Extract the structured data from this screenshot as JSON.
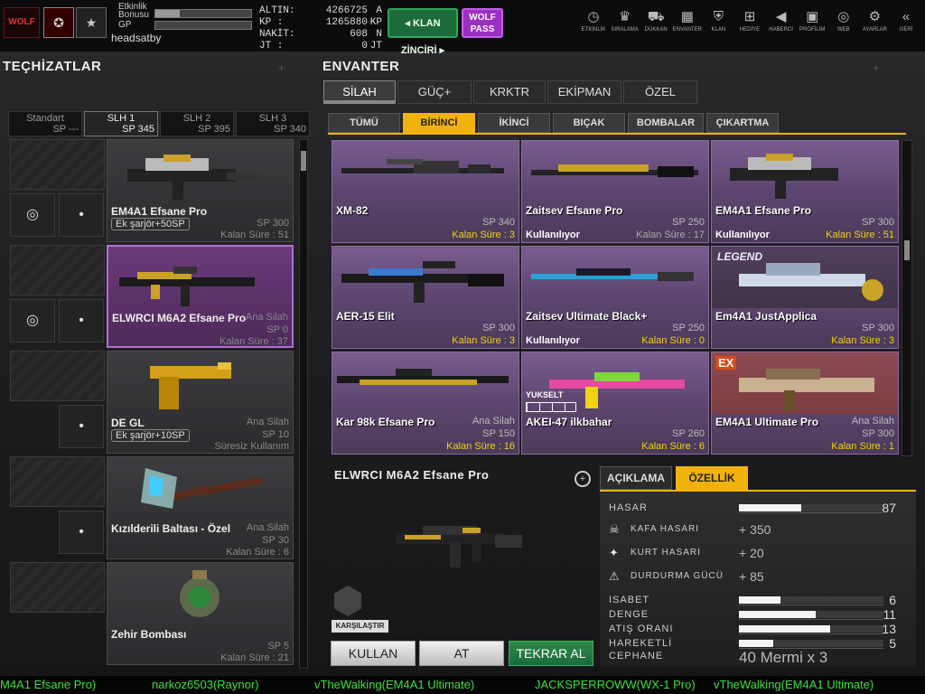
{
  "topbar": {
    "logo_text": "WOLF",
    "event_bonus_label": "Etkinlik Bonusu",
    "event_bonus_fill": 0.25,
    "gp_label": "GP",
    "gp_fill": 0.0,
    "username": "headsatby",
    "stats": [
      {
        "key": "ALTIN:",
        "value": "4266725",
        "unit": "A"
      },
      {
        "key": "KP :",
        "value": "1265880",
        "unit": "KP"
      },
      {
        "key": "NAKİT:",
        "value": "608",
        "unit": "N"
      },
      {
        "key": "JT :",
        "value": "0",
        "unit": "JT"
      }
    ],
    "klan_button": "KLAN ZİNCİRİ",
    "wolf_pass_line1": "WOLF",
    "wolf_pass_line2": "PASS",
    "nav": [
      {
        "label": "ETKİNLİK",
        "icon": "clock-icon",
        "glyph": "◷"
      },
      {
        "label": "SIRALAMA",
        "icon": "ranking-icon",
        "glyph": "♛"
      },
      {
        "label": "DÜKKAN",
        "icon": "cart-icon",
        "glyph": "⛟"
      },
      {
        "label": "ENVANTER",
        "icon": "inventory-icon",
        "glyph": "▦"
      },
      {
        "label": "KLAN",
        "icon": "shield-icon",
        "glyph": "⛨"
      },
      {
        "label": "HEDİYE",
        "icon": "gift-icon",
        "glyph": "⊞"
      },
      {
        "label": "HABERCİ",
        "icon": "megaphone-icon",
        "glyph": "◀"
      },
      {
        "label": "PROFİLİM",
        "icon": "profile-icon",
        "glyph": "▣"
      },
      {
        "label": "WEB",
        "icon": "globe-icon",
        "glyph": "◎"
      },
      {
        "label": "AYARLAR",
        "icon": "gear-icon",
        "glyph": "⚙"
      },
      {
        "label": "GERİ",
        "icon": "back-icon",
        "glyph": "«"
      }
    ]
  },
  "left": {
    "title": "TEÇHİZATLAR",
    "slots": [
      {
        "name": "Standart",
        "sp": "SP ---"
      },
      {
        "name": "SLH 1",
        "sp": "SP 345"
      },
      {
        "name": "SLH 2",
        "sp": "SP 395"
      },
      {
        "name": "SLH 3",
        "sp": "SP 340"
      }
    ],
    "equipment": [
      {
        "name": "EM4A1 Efsane Pro",
        "slot": "",
        "sp": "SP 300",
        "extra": "Ek şarjör+50SP",
        "time": "Kalan Süre : 51"
      },
      {
        "name": "ELWRCI M6A2 Efsane Pro",
        "slot": "Ana Silah",
        "sp": "SP 0",
        "extra": "",
        "time": "Kalan Süre : 37"
      },
      {
        "name": "DE GL",
        "slot": "Ana Silah",
        "sp": "SP 10",
        "extra": "Ek şarjör+10SP",
        "time": "Süresiz Kullanım"
      },
      {
        "name": "Kızılderili Baltası - Özel",
        "slot": "Ana Silah",
        "sp": "SP 30",
        "extra": "",
        "time": "Kalan Süre : 6"
      },
      {
        "name": "Zehir Bombası",
        "slot": "",
        "sp": "SP 5",
        "extra": "",
        "time": "Kalan Süre : 21"
      }
    ]
  },
  "inventory": {
    "title": "ENVANTER",
    "tabs": [
      "SİLAH",
      "GÜÇ+",
      "KRKTR",
      "EKİPMAN",
      "ÖZEL"
    ],
    "subtabs": [
      "TÜMÜ",
      "BİRİNCİ",
      "İKİNCİ",
      "BIÇAK",
      "BOMBALAR",
      "ÇIKARTMA"
    ],
    "items": [
      {
        "name": "XM-82",
        "slot": "",
        "sp": "SP 340",
        "status": "",
        "time": "Kalan Süre : 3"
      },
      {
        "name": "Zaitsev Efsane Pro",
        "slot": "",
        "sp": "SP 250",
        "status": "Kullanılıyor",
        "time": "Kalan Süre : 17"
      },
      {
        "name": "EM4A1 Efsane Pro",
        "slot": "",
        "sp": "SP 300",
        "status": "Kullanılıyor",
        "time": "Kalan Süre : 51"
      },
      {
        "name": "AER-15 Elit",
        "slot": "",
        "sp": "SP 300",
        "status": "",
        "time": "Kalan Süre : 3"
      },
      {
        "name": "Zaitsev Ultimate Black+",
        "slot": "",
        "sp": "SP 250",
        "status": "Kullanılıyor",
        "time": "Kalan Süre : 0"
      },
      {
        "name": "Em4A1 JustApplica",
        "slot": "",
        "sp": "SP 300",
        "status": "",
        "time": "Kalan Süre : 3"
      },
      {
        "name": "Kar 98k Efsane Pro",
        "slot": "Ana Silah",
        "sp": "SP 150",
        "status": "",
        "time": "Kalan Süre : 16"
      },
      {
        "name": "AKEI-47 ilkbahar",
        "slot": "",
        "sp": "SP 260",
        "status": "",
        "time": "Kalan Süre : 6"
      },
      {
        "name": "EM4A1 Ultimate Pro",
        "slot": "Ana Silah",
        "sp": "SP 300",
        "status": "",
        "time": "Kalan Süre : 1"
      }
    ],
    "badges": {
      "legend": "LEGEND",
      "upgrade": "YUKSELT",
      "ex": "EX"
    }
  },
  "detail": {
    "name": "ELWRCI M6A2 Efsane Pro",
    "tabs": [
      "AÇIKLAMA",
      "ÖZELLİK"
    ],
    "bar_stats": [
      {
        "label": "HASAR",
        "fill": 0.43,
        "value": "87"
      },
      {
        "label": "ISABET",
        "fill": 0.29,
        "value": "6"
      },
      {
        "label": "DENGE",
        "fill": 0.53,
        "value": "11"
      },
      {
        "label": "ATIŞ ORANI",
        "fill": 0.63,
        "value": "13"
      },
      {
        "label": "HAREKETLİ",
        "fill": 0.24,
        "value": "5"
      }
    ],
    "bonus_stats": [
      {
        "label": "KAFA HASARI",
        "value": "+ 350",
        "icon": "skull-icon",
        "glyph": "☠"
      },
      {
        "label": "KURT HASARI",
        "value": "+ 20",
        "icon": "wolf-icon",
        "glyph": "✦"
      },
      {
        "label": "DURDURMA GÜCÜ",
        "value": "+ 85",
        "icon": "stop-power-icon",
        "glyph": "⚠"
      }
    ],
    "ammo_label": "CEPHANE",
    "ammo_value": "40 Mermi x 3",
    "compare": "KARŞILAŞTIR",
    "buttons": {
      "use": "KULLAN",
      "drop": "AT",
      "renew": "TEKRAR AL"
    }
  },
  "ticker": [
    "M4A1 Efsane Pro)",
    "narkoz6503(Raynor)",
    "vTheWalking(EM4A1 Ultimate)",
    "JACKSPERROWW(WX-1 Pro)",
    "vTheWalking(EM4A1 Ultimate)"
  ]
}
